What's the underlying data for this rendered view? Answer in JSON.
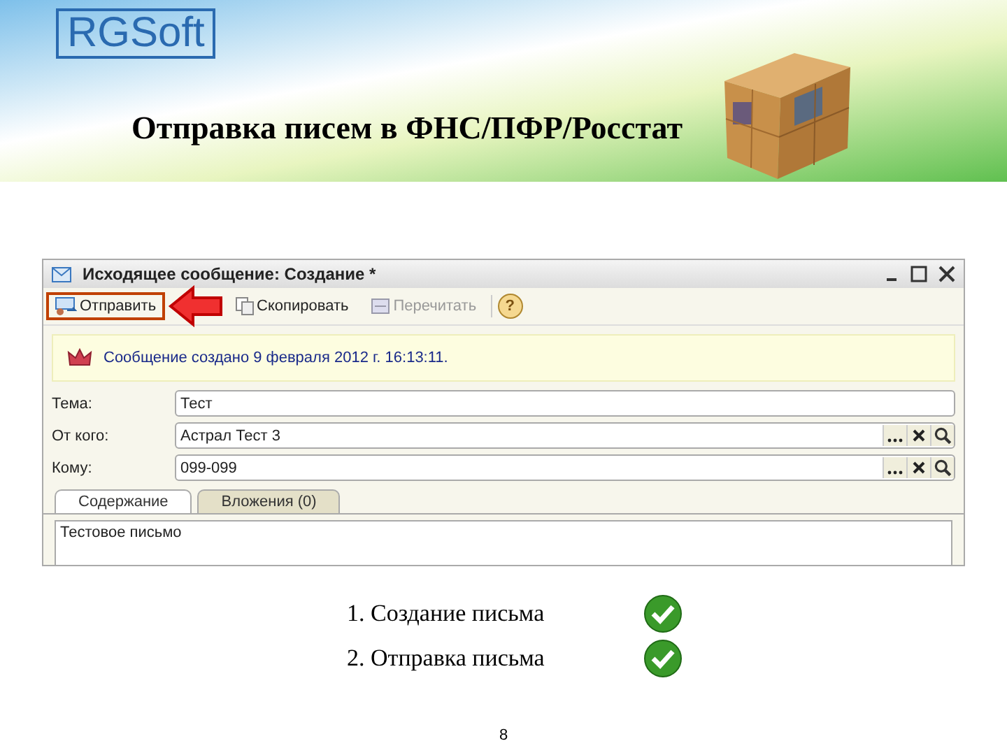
{
  "slide": {
    "logo": "RGSoft",
    "title": "Отправка писем в ФНС/ПФР/Росстат",
    "page_number": "8"
  },
  "window": {
    "title": "Исходящее сообщение: Создание *",
    "toolbar": [
      {
        "label": "Отправить",
        "highlighted": true,
        "disabled": false
      },
      {
        "label": "Скопировать",
        "highlighted": false,
        "disabled": false
      },
      {
        "label": "Перечитать",
        "highlighted": false,
        "disabled": true
      }
    ],
    "help": "?",
    "info": "Сообщение создано 9 февраля 2012 г. 16:13:11.",
    "fields": [
      {
        "label": "Тема:",
        "value": "Тест",
        "kind": "text"
      },
      {
        "label": "От кого:",
        "value": "Астрал Тест 3",
        "kind": "lookup"
      },
      {
        "label": "Кому:",
        "value": "099-099",
        "kind": "lookup"
      }
    ],
    "tabs": [
      {
        "label": "Содержание",
        "selected": true
      },
      {
        "label": "Вложения (0)",
        "selected": false
      }
    ],
    "body": "Тестовое письмо"
  },
  "steps": [
    {
      "label": "1. Создание письма",
      "done": true
    },
    {
      "label": "2. Отправка письма",
      "done": true
    }
  ]
}
